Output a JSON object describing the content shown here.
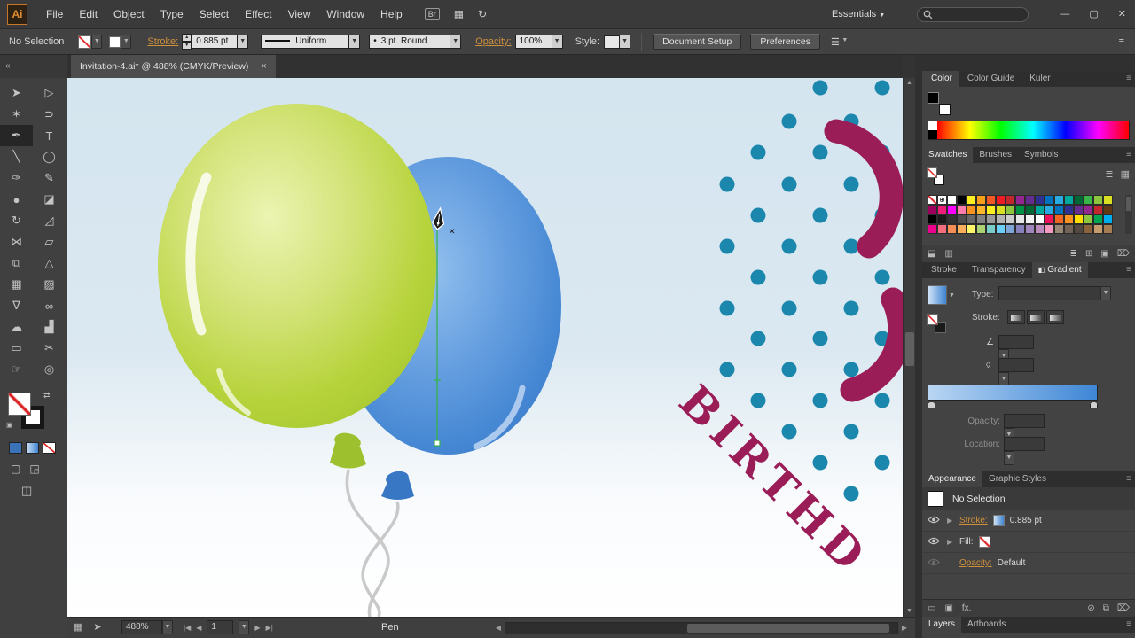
{
  "colors": {
    "accent_link": "#d1913c",
    "maroon": "#9b1d57",
    "teal_dot": "#1b87ad",
    "balloon_green": "#b7d33c",
    "balloon_blue": "#4587d3",
    "pen_path_green": "#35b44a",
    "canvas_top": "#d6e6f0"
  },
  "menubar": {
    "logo": "Ai",
    "items": [
      {
        "label": "File",
        "name": "menu-file"
      },
      {
        "label": "Edit",
        "name": "menu-edit"
      },
      {
        "label": "Object",
        "name": "menu-object"
      },
      {
        "label": "Type",
        "name": "menu-type"
      },
      {
        "label": "Select",
        "name": "menu-select"
      },
      {
        "label": "Effect",
        "name": "menu-effect"
      },
      {
        "label": "View",
        "name": "menu-view"
      },
      {
        "label": "Window",
        "name": "menu-window"
      },
      {
        "label": "Help",
        "name": "menu-help"
      }
    ],
    "bridge": "Br",
    "workspace": "Essentials",
    "search_placeholder": ""
  },
  "controlbar": {
    "selection_status": "No Selection",
    "stroke_label": "Stroke:",
    "stroke_value": "0.885 pt",
    "width_profile": "Uniform",
    "brush": "3 pt. Round",
    "opacity_label": "Opacity:",
    "opacity_value": "100%",
    "style_label": "Style:",
    "document_setup": "Document Setup",
    "preferences": "Preferences"
  },
  "document_tab": {
    "title": "Invitation-4.ai* @ 488% (CMYK/Preview)",
    "close": "×"
  },
  "toolbar": {
    "collapse": "«",
    "tools": [
      {
        "name": "selection-tool",
        "glyph": "➤"
      },
      {
        "name": "direct-selection-tool",
        "glyph": "▷"
      },
      {
        "name": "magic-wand-tool",
        "glyph": "✶"
      },
      {
        "name": "lasso-tool",
        "glyph": "⊃"
      },
      {
        "name": "pen-tool",
        "glyph": "✒",
        "active": true
      },
      {
        "name": "type-tool",
        "glyph": "T"
      },
      {
        "name": "line-segment-tool",
        "glyph": "╲"
      },
      {
        "name": "ellipse-tool",
        "glyph": "◯"
      },
      {
        "name": "paintbrush-tool",
        "glyph": "✑"
      },
      {
        "name": "pencil-tool",
        "glyph": "✎"
      },
      {
        "name": "blob-brush-tool",
        "glyph": "●"
      },
      {
        "name": "eraser-tool",
        "glyph": "◪"
      },
      {
        "name": "rotate-tool",
        "glyph": "↻"
      },
      {
        "name": "scale-tool",
        "glyph": "◿"
      },
      {
        "name": "width-tool",
        "glyph": "⋈"
      },
      {
        "name": "free-transform-tool",
        "glyph": "▱"
      },
      {
        "name": "shape-builder-tool",
        "glyph": "⧉"
      },
      {
        "name": "perspective-grid-tool",
        "glyph": "△"
      },
      {
        "name": "mesh-tool",
        "glyph": "▦"
      },
      {
        "name": "gradient-tool",
        "glyph": "▨"
      },
      {
        "name": "eyedropper-tool",
        "glyph": "∇"
      },
      {
        "name": "blend-tool",
        "glyph": "∞"
      },
      {
        "name": "symbol-sprayer-tool",
        "glyph": "☁"
      },
      {
        "name": "column-graph-tool",
        "glyph": "▟"
      },
      {
        "name": "artboard-tool",
        "glyph": "▭"
      },
      {
        "name": "slice-tool",
        "glyph": "✂"
      },
      {
        "name": "hand-tool",
        "glyph": "☞"
      },
      {
        "name": "zoom-tool",
        "glyph": "◎"
      }
    ]
  },
  "canvas": {
    "birthday_text": "BIRTHD"
  },
  "panels": {
    "color": {
      "tabs": [
        {
          "label": "Color",
          "active": true,
          "name": "tab-color"
        },
        {
          "label": "Color Guide",
          "name": "tab-color-guide"
        },
        {
          "label": "Kuler",
          "name": "tab-kuler"
        }
      ]
    },
    "swatches": {
      "tabs": [
        {
          "label": "Swatches",
          "active": true,
          "name": "tab-swatches"
        },
        {
          "label": "Brushes",
          "name": "tab-brushes"
        },
        {
          "label": "Symbols",
          "name": "tab-symbols"
        }
      ],
      "cells": [
        "none",
        "reg",
        "#ffffff",
        "#000000",
        "#fcee21",
        "#f9a01b",
        "#f15a24",
        "#ed1c24",
        "#c1272d",
        "#93278f",
        "#662d91",
        "#2e3192",
        "#0071bc",
        "#29abe2",
        "#00a99d",
        "#006837",
        "#39b54a",
        "#8cc63f",
        "#d9e021",
        "#9e005d",
        "#ed1e79",
        "#ff00ff",
        "#ff7bac",
        "#f7931e",
        "#ffb62b",
        "#fcee21",
        "#d9e021",
        "#8cc63f",
        "#009245",
        "#006837",
        "#00a99d",
        "#29abe2",
        "#0071bc",
        "#2e3192",
        "#662d91",
        "#93278f",
        "#c1272d",
        "#603813",
        "#000000",
        "#1a1a1a",
        "#333333",
        "#4d4d4d",
        "#666666",
        "#808080",
        "#999999",
        "#b3b3b3",
        "#cccccc",
        "#e6e6e6",
        "#f2f2f2",
        "#ffffff",
        "#ed145b",
        "#f26522",
        "#f8931f",
        "#ffdd00",
        "#8dc63f",
        "#00a651",
        "#00aeef",
        "#ec008c",
        "#f26d7d",
        "#f68e56",
        "#fbaf5d",
        "#fff568",
        "#acd373",
        "#7accc8",
        "#6dcff6",
        "#7da7d9",
        "#8781bd",
        "#a186be",
        "#bd8cbf",
        "#f49ac1",
        "#998675",
        "#736357",
        "#534741",
        "#8c6239",
        "#c69c6d",
        "#a67c52"
      ],
      "footer_left": [
        {
          "name": "swatch-libraries-icon",
          "glyph": "⬓"
        },
        {
          "name": "swatch-kinds-icon",
          "glyph": "▥"
        }
      ],
      "footer_right": [
        {
          "name": "swatch-options-icon",
          "glyph": "≣"
        },
        {
          "name": "new-color-group-icon",
          "glyph": "⊞"
        },
        {
          "name": "new-swatch-icon",
          "glyph": "▣"
        },
        {
          "name": "delete-swatch-icon",
          "glyph": "⌦"
        }
      ]
    },
    "gradient": {
      "tabs": [
        {
          "label": "Stroke",
          "name": "tab-stroke"
        },
        {
          "label": "Transparency",
          "name": "tab-transparency"
        },
        {
          "label": "Gradient",
          "active": true,
          "icon": "◧",
          "name": "tab-gradient"
        }
      ],
      "type_label": "Type:",
      "stroke_label": "Stroke:",
      "angle_icon": "∠",
      "aspect_icon": "◊",
      "opacity_label": "Opacity:",
      "location_label": "Location:"
    },
    "appearance": {
      "tabs": [
        {
          "label": "Appearance",
          "active": true,
          "name": "tab-appearance"
        },
        {
          "label": "Graphic Styles",
          "name": "tab-graphic-styles"
        }
      ],
      "header": "No Selection",
      "rows": [
        {
          "name": "stroke",
          "label": "Stroke:",
          "chip": "gradient",
          "value": "0.885 pt",
          "link": true
        },
        {
          "name": "fill",
          "label": "Fill:",
          "chip": "none",
          "value": ""
        },
        {
          "name": "opacity",
          "label": "Opacity:",
          "value": "Default",
          "link": true,
          "dim": true,
          "noarrow": true
        }
      ],
      "footer_left": [
        {
          "name": "add-stroke-icon",
          "glyph": "▭"
        },
        {
          "name": "add-fill-icon",
          "glyph": "▣"
        },
        {
          "name": "add-effect-icon",
          "glyph": "fx."
        }
      ],
      "footer_right": [
        {
          "name": "clear-appearance-icon",
          "glyph": "⊘"
        },
        {
          "name": "duplicate-item-icon",
          "glyph": "⧉"
        },
        {
          "name": "delete-item-icon",
          "glyph": "⌦"
        }
      ]
    },
    "layers": {
      "tabs": [
        {
          "label": "Layers",
          "active": true,
          "name": "tab-layers"
        },
        {
          "label": "Artboards",
          "name": "tab-artboards"
        }
      ]
    }
  },
  "statusbar": {
    "zoom": "488%",
    "artboard": "1",
    "tool": "Pen"
  }
}
